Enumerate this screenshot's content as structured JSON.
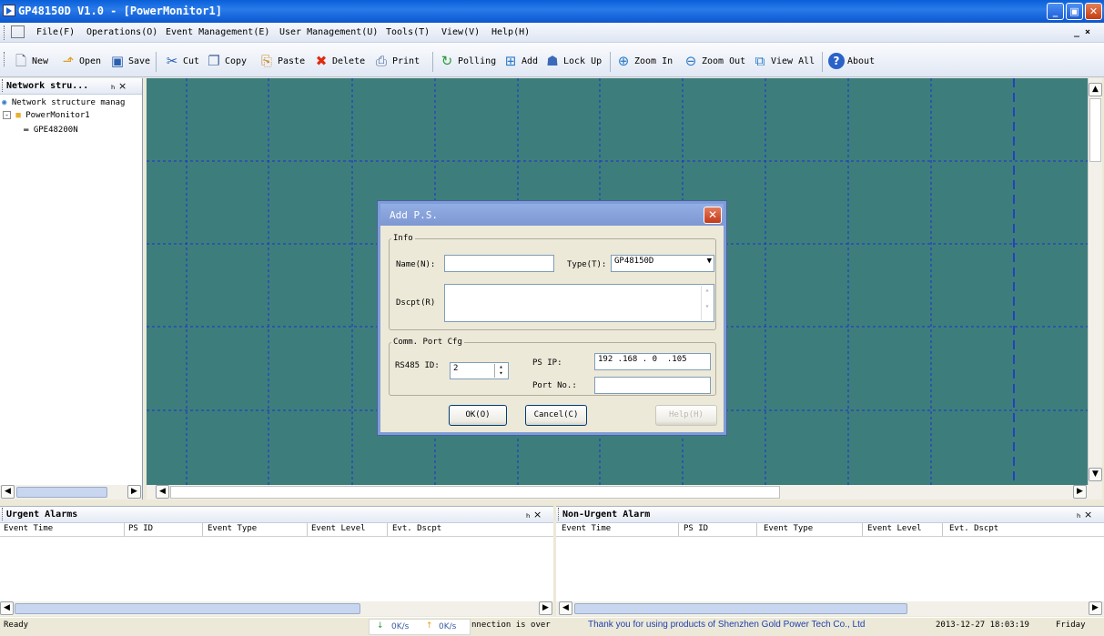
{
  "window": {
    "title": "GP48150D V1.0 - [PowerMonitor1]"
  },
  "menu": {
    "items": [
      "File(F)",
      "Operations(O)",
      "Event Management(E)",
      "User Management(U)",
      "Tools(T)",
      "View(V)",
      "Help(H)"
    ],
    "mdi_controls": "_ ×"
  },
  "toolbar": {
    "buttons": [
      {
        "label": "New",
        "icon": "new-icon"
      },
      {
        "label": "Open",
        "icon": "open-icon"
      },
      {
        "label": "Save",
        "icon": "save-icon"
      },
      {
        "label": "Cut",
        "icon": "cut-icon"
      },
      {
        "label": "Copy",
        "icon": "copy-icon"
      },
      {
        "label": "Paste",
        "icon": "paste-icon"
      },
      {
        "label": "Delete",
        "icon": "delete-icon"
      },
      {
        "label": "Print",
        "icon": "print-icon"
      },
      {
        "label": "Polling",
        "icon": "polling-icon"
      },
      {
        "label": "Add",
        "icon": "add-icon"
      },
      {
        "label": "Lock Up",
        "icon": "lock-icon"
      },
      {
        "label": "Zoom In",
        "icon": "zoom-in-icon"
      },
      {
        "label": "Zoom Out",
        "icon": "zoom-out-icon"
      },
      {
        "label": "View All",
        "icon": "view-all-icon"
      },
      {
        "label": "About",
        "icon": "about-icon"
      }
    ]
  },
  "network_panel": {
    "title": "Network stru...",
    "pin": "ₕ ×",
    "tree": [
      {
        "label": "Network structure manag"
      },
      {
        "label": "PowerMonitor1"
      },
      {
        "label": "GPE48200N"
      }
    ]
  },
  "dialog": {
    "title": "Add P.S.",
    "info_group": "Info",
    "name_label": "Name(N):",
    "name_value": "",
    "type_label": "Type(T):",
    "type_value": "GP48150D",
    "desc_label": "Dscpt(R)",
    "desc_value": "",
    "comm_group": "Comm. Port Cfg",
    "rs485_label": "RS485 ID:",
    "rs485_value": "2",
    "ps_ip_label": "PS IP:",
    "ps_ip_value": "192 .168 . 0  .105",
    "port_label": "Port No.:",
    "port_value": "",
    "ok": "OK(O)",
    "cancel": "Cancel(C)",
    "help": "Help(H)"
  },
  "urgent_alarms": {
    "title": "Urgent Alarms",
    "columns": [
      "Event Time",
      "PS ID",
      "Event Type",
      "Event Level",
      "Evt. Dscpt"
    ]
  },
  "non_urgent_alarms": {
    "title": "Non-Urgent Alarm",
    "columns": [
      "Event Time",
      "PS ID",
      "Event Type",
      "Event Level",
      "Evt. Dscpt"
    ]
  },
  "status": {
    "ready": "Ready",
    "down_speed": "0K/s",
    "up_speed": "0K/s",
    "connection": "nnection is over",
    "thanks": "Thank you for using products of Shenzhen Gold Power Tech Co., Ltd",
    "datetime": "2013-12-27 18:03:19",
    "weekday": "Friday"
  },
  "colors": {
    "canvas": "#3D7E7C",
    "title_bar": "#0A5FD8",
    "thanks_text": "#1F3FB0"
  }
}
